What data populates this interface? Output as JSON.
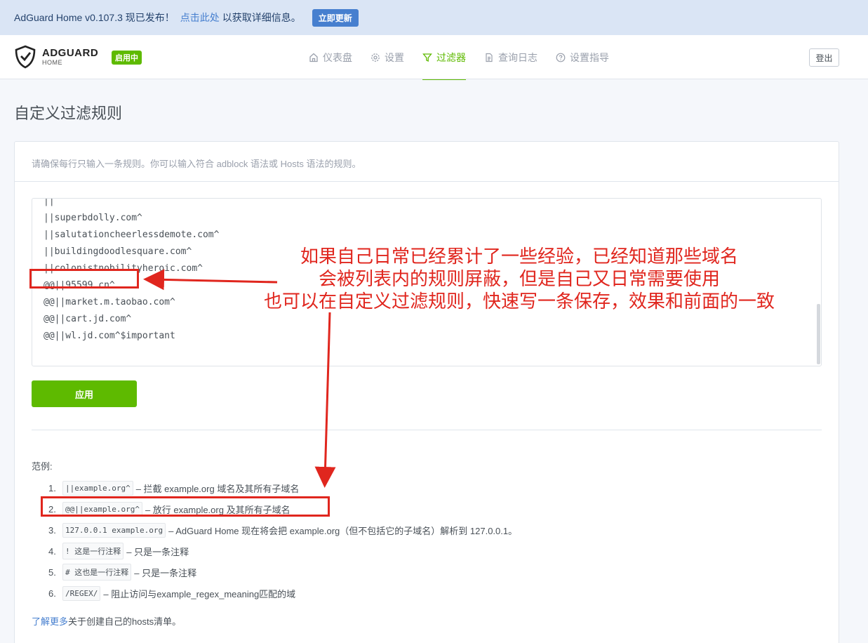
{
  "banner": {
    "message": "AdGuard Home v0.107.3 现已发布！",
    "link_text": "点击此处",
    "suffix": "以获取详细信息。",
    "update_button": "立即更新"
  },
  "header": {
    "brand_main": "ADGUARD",
    "brand_sub": "HOME",
    "status_badge": "启用中",
    "nav": [
      {
        "label": "仪表盘",
        "icon": "home-icon"
      },
      {
        "label": "设置",
        "icon": "gear-icon"
      },
      {
        "label": "过滤器",
        "icon": "filter-icon"
      },
      {
        "label": "查询日志",
        "icon": "document-icon"
      },
      {
        "label": "设置指导",
        "icon": "help-icon"
      }
    ],
    "logout": "登出"
  },
  "page": {
    "title": "自定义过滤规则",
    "description": "请确保每行只输入一条规则。你可以输入符合 adblock 语法或 Hosts 语法的规则。",
    "rules": [
      "||superbdolly.com^",
      "||salutationcheerlessdemote.com^",
      "||buildingdoodlesquare.com^",
      "||colonistnobilityheroic.com^",
      "@@||95599.cn^",
      "@@||market.m.taobao.com^",
      "@@||cart.jd.com^",
      "@@||wl.jd.com^$important"
    ],
    "apply_button": "应用",
    "examples_title": "范例:",
    "examples": [
      {
        "num": "1.",
        "code": "||example.org^",
        "text": "– 拦截 example.org 域名及其所有子域名"
      },
      {
        "num": "2.",
        "code": "@@||example.org^",
        "text": "– 放行 example.org 及其所有子域名"
      },
      {
        "num": "3.",
        "code": "127.0.0.1 example.org",
        "text": "– AdGuard Home 现在将会把 example.org（但不包括它的子域名）解析到 127.0.0.1。"
      },
      {
        "num": "4.",
        "code": "! 这是一行注释",
        "text": "– 只是一条注释"
      },
      {
        "num": "5.",
        "code": "# 这也是一行注释",
        "text": "– 只是一条注释"
      },
      {
        "num": "6.",
        "code": "/REGEX/",
        "text": "– 阻止访问与example_regex_meaning匹配的域"
      }
    ],
    "learn_more_link": "了解更多",
    "learn_more_suffix": "关于创建自己的hosts清单。"
  },
  "annotation": {
    "line1": "如果自己日常已经累计了一些经验，已经知道那些域名",
    "line2": "会被列表内的规则屏蔽，但是自己又日常需要使用",
    "line3": "也可以在自定义过滤规则，快速写一条保存，效果和前面的一致",
    "color": "#e0261e"
  },
  "colors": {
    "accent": "#5eba00",
    "link": "#467fcf",
    "banner_bg": "#dae5f5"
  }
}
